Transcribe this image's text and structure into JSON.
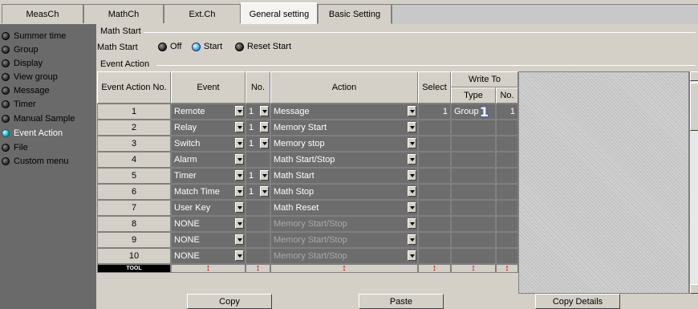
{
  "tabs": [
    {
      "label": "MeasCh"
    },
    {
      "label": "MathCh"
    },
    {
      "label": "Ext.Ch"
    },
    {
      "label": "General setting"
    },
    {
      "label": "Basic Setting"
    }
  ],
  "sidebar": {
    "items": [
      {
        "label": "Summer time",
        "icon": "radio-dot-icon"
      },
      {
        "label": "Group",
        "icon": "radio-dot-icon"
      },
      {
        "label": "Display",
        "icon": "radio-dot-icon"
      },
      {
        "label": "View group",
        "icon": "radio-dot-icon"
      },
      {
        "label": "Message",
        "icon": "radio-dot-icon"
      },
      {
        "label": "Timer",
        "icon": "radio-dot-icon"
      },
      {
        "label": "Manual Sample",
        "icon": "radio-dot-icon"
      },
      {
        "label": "Event Action",
        "icon": "radio-dot-icon",
        "selected": true
      },
      {
        "label": "File",
        "icon": "radio-dot-icon"
      },
      {
        "label": "Custom menu",
        "icon": "radio-dot-icon"
      }
    ]
  },
  "math_start": {
    "group_label": "Math Start",
    "field_label": "Math Start",
    "options": [
      "Off",
      "Start",
      "Reset Start"
    ],
    "selected": "Start"
  },
  "event_action": {
    "group_label": "Event Action",
    "headers": {
      "no": "Event Action No.",
      "event": "Event",
      "num": "No.",
      "action": "Action",
      "select": "Select",
      "write_to": "Write To",
      "type": "Type",
      "wno": "No."
    },
    "rows": [
      {
        "no": "1",
        "event": "Remote",
        "num": "1",
        "action": "Message",
        "select": "1",
        "type": "Group",
        "wno": "1",
        "disabled": false
      },
      {
        "no": "2",
        "event": "Relay",
        "num": "1",
        "action": "Memory Start",
        "select": "",
        "type": "",
        "wno": "",
        "disabled": false
      },
      {
        "no": "3",
        "event": "Switch",
        "num": "1",
        "action": "Memory stop",
        "select": "",
        "type": "",
        "wno": "",
        "disabled": false
      },
      {
        "no": "4",
        "event": "Alarm",
        "num": "",
        "action": "Math Start/Stop",
        "select": "",
        "type": "",
        "wno": "",
        "disabled": false
      },
      {
        "no": "5",
        "event": "Timer",
        "num": "1",
        "action": "Math Start",
        "select": "",
        "type": "",
        "wno": "",
        "disabled": false
      },
      {
        "no": "6",
        "event": "Match Time",
        "num": "1",
        "action": "Math Stop",
        "select": "",
        "type": "",
        "wno": "",
        "disabled": false
      },
      {
        "no": "7",
        "event": "User Key",
        "num": "",
        "action": "Math Reset",
        "select": "",
        "type": "",
        "wno": "",
        "disabled": false
      },
      {
        "no": "8",
        "event": "NONE",
        "num": "",
        "action": "Memory Start/Stop",
        "select": "",
        "type": "",
        "wno": "",
        "disabled": true
      },
      {
        "no": "9",
        "event": "NONE",
        "num": "",
        "action": "Memory Start/Stop",
        "select": "",
        "type": "",
        "wno": "",
        "disabled": true
      },
      {
        "no": "10",
        "event": "NONE",
        "num": "",
        "action": "Memory Start/Stop",
        "select": "",
        "type": "",
        "wno": "",
        "disabled": true
      }
    ],
    "tool_label": "TOOL",
    "tool_arrow": "↕"
  },
  "buttons": {
    "copy": "Copy",
    "paste": "Paste",
    "copy_details": "Copy Details"
  }
}
